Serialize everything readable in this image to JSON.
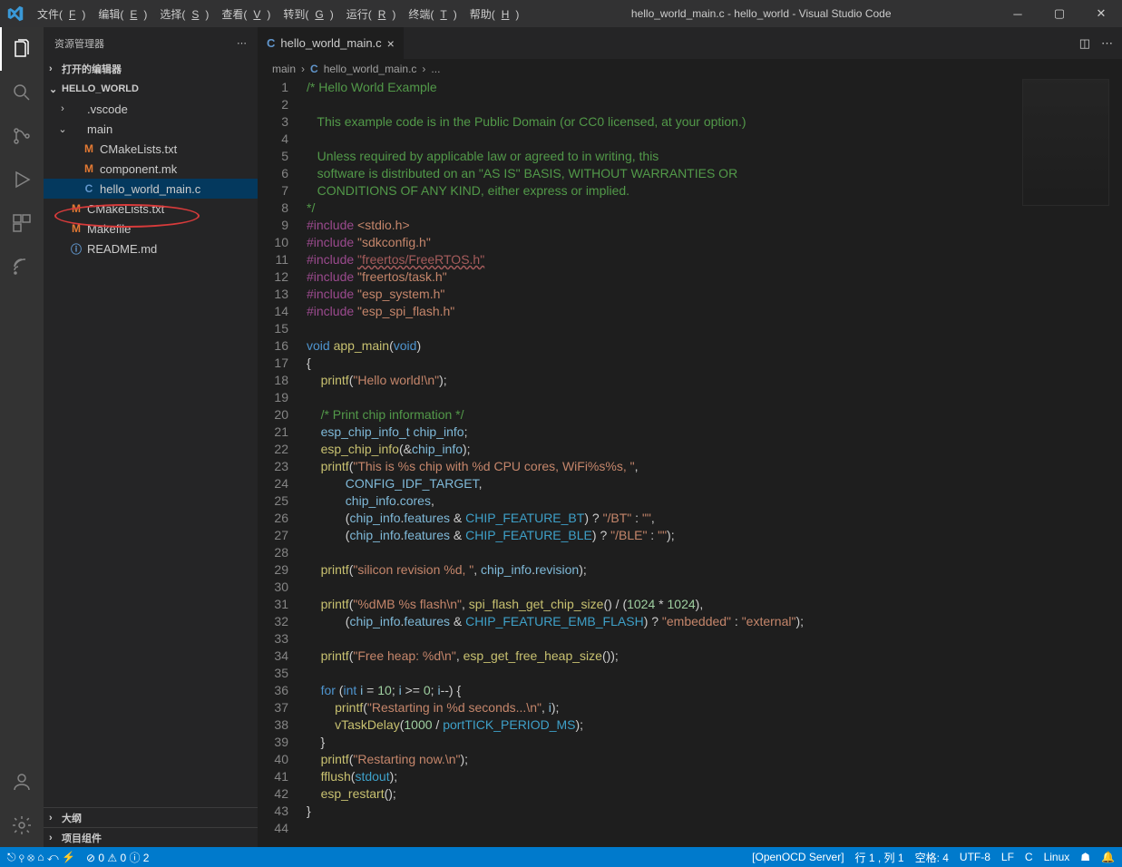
{
  "window": {
    "title": "hello_world_main.c - hello_world - Visual Studio Code"
  },
  "menus": [
    "文件(F)",
    "编辑(E)",
    "选择(S)",
    "查看(V)",
    "转到(G)",
    "运行(R)",
    "终端(T)",
    "帮助(H)"
  ],
  "sidebar": {
    "title": "资源管理器",
    "sections": {
      "openEditors": "打开的编辑器",
      "project": "HELLO_WORLD",
      "outline": "大纲",
      "projectComp": "项目组件"
    },
    "tree": [
      {
        "indent": 0,
        "chev": "›",
        "icon": "",
        "iconColor": "",
        "label": ".vscode"
      },
      {
        "indent": 0,
        "chev": "⌄",
        "icon": "",
        "iconColor": "",
        "label": "main"
      },
      {
        "indent": 1,
        "chev": "",
        "icon": "M",
        "iconColor": "#e37933",
        "label": "CMakeLists.txt"
      },
      {
        "indent": 1,
        "chev": "",
        "icon": "M",
        "iconColor": "#e37933",
        "label": "component.mk"
      },
      {
        "indent": 1,
        "chev": "",
        "icon": "C",
        "iconColor": "#6196cc",
        "label": "hello_world_main.c",
        "selected": true
      },
      {
        "indent": 0,
        "chev": "",
        "icon": "M",
        "iconColor": "#e37933",
        "label": "CMakeLists.txt"
      },
      {
        "indent": 0,
        "chev": "",
        "icon": "M",
        "iconColor": "#e37933",
        "label": "Makefile"
      },
      {
        "indent": 0,
        "chev": "",
        "icon": "ⓘ",
        "iconColor": "#6196cc",
        "label": "README.md"
      }
    ]
  },
  "tab": {
    "icon": "C",
    "label": "hello_world_main.c"
  },
  "breadcrumb": [
    "main",
    "hello_world_main.c",
    "..."
  ],
  "code": {
    "firstLine": 1,
    "lines": [
      [
        {
          "c": "cm",
          "t": "/* Hello World Example"
        }
      ],
      [
        {
          "c": "cm",
          "t": ""
        }
      ],
      [
        {
          "c": "cm",
          "t": "   This example code is in the Public Domain (or CC0 licensed, at your option.)"
        }
      ],
      [
        {
          "c": "cm",
          "t": ""
        }
      ],
      [
        {
          "c": "cm",
          "t": "   Unless required by applicable law or agreed to in writing, this"
        }
      ],
      [
        {
          "c": "cm",
          "t": "   software is distributed on an \"AS IS\" BASIS, WITHOUT WARRANTIES OR"
        }
      ],
      [
        {
          "c": "cm",
          "t": "   CONDITIONS OF ANY KIND, either express or implied."
        }
      ],
      [
        {
          "c": "cm",
          "t": "*/"
        }
      ],
      [
        {
          "c": "pp",
          "t": "#include "
        },
        {
          "c": "s",
          "t": "<stdio.h>"
        }
      ],
      [
        {
          "c": "pp",
          "t": "#include "
        },
        {
          "c": "s",
          "t": "\"sdkconfig.h\""
        }
      ],
      [
        {
          "c": "pp",
          "t": "#include "
        },
        {
          "c": "sq",
          "t": "\"freertos/FreeRTOS.h\""
        }
      ],
      [
        {
          "c": "pp",
          "t": "#include "
        },
        {
          "c": "s",
          "t": "\"freertos/task.h\""
        }
      ],
      [
        {
          "c": "pp",
          "t": "#include "
        },
        {
          "c": "s",
          "t": "\"esp_system.h\""
        }
      ],
      [
        {
          "c": "pp",
          "t": "#include "
        },
        {
          "c": "s",
          "t": "\"esp_spi_flash.h\""
        }
      ],
      [],
      [
        {
          "c": "kw",
          "t": "void "
        },
        {
          "c": "fn",
          "t": "app_main"
        },
        {
          "t": "("
        },
        {
          "c": "kw",
          "t": "void"
        },
        {
          "t": ")"
        }
      ],
      [
        {
          "t": "{"
        }
      ],
      [
        {
          "t": "    "
        },
        {
          "c": "fn",
          "t": "printf"
        },
        {
          "t": "("
        },
        {
          "c": "s",
          "t": "\"Hello world!\\n\""
        },
        {
          "t": ");"
        }
      ],
      [],
      [
        {
          "t": "    "
        },
        {
          "c": "cm",
          "t": "/* Print chip information */"
        }
      ],
      [
        {
          "t": "    "
        },
        {
          "c": "vr",
          "t": "esp_chip_info_t"
        },
        {
          "t": " "
        },
        {
          "c": "vr",
          "t": "chip_info"
        },
        {
          "t": ";"
        }
      ],
      [
        {
          "t": "    "
        },
        {
          "c": "fn",
          "t": "esp_chip_info"
        },
        {
          "t": "(&"
        },
        {
          "c": "vr",
          "t": "chip_info"
        },
        {
          "t": ");"
        }
      ],
      [
        {
          "t": "    "
        },
        {
          "c": "fn",
          "t": "printf"
        },
        {
          "t": "("
        },
        {
          "c": "s",
          "t": "\"This is %s chip with %d CPU cores, WiFi%s%s, \""
        },
        {
          "t": ","
        }
      ],
      [
        {
          "t": "           "
        },
        {
          "c": "vr",
          "t": "CONFIG_IDF_TARGET"
        },
        {
          "t": ","
        }
      ],
      [
        {
          "t": "           "
        },
        {
          "c": "vr",
          "t": "chip_info"
        },
        {
          "t": "."
        },
        {
          "c": "vr",
          "t": "cores"
        },
        {
          "t": ","
        }
      ],
      [
        {
          "t": "           ("
        },
        {
          "c": "vr",
          "t": "chip_info"
        },
        {
          "t": "."
        },
        {
          "c": "vr",
          "t": "features"
        },
        {
          "t": " & "
        },
        {
          "c": "cn",
          "t": "CHIP_FEATURE_BT"
        },
        {
          "t": ") ? "
        },
        {
          "c": "s",
          "t": "\"/BT\""
        },
        {
          "t": " : "
        },
        {
          "c": "s",
          "t": "\"\""
        },
        {
          "t": ","
        }
      ],
      [
        {
          "t": "           ("
        },
        {
          "c": "vr",
          "t": "chip_info"
        },
        {
          "t": "."
        },
        {
          "c": "vr",
          "t": "features"
        },
        {
          "t": " & "
        },
        {
          "c": "cn",
          "t": "CHIP_FEATURE_BLE"
        },
        {
          "t": ") ? "
        },
        {
          "c": "s",
          "t": "\"/BLE\""
        },
        {
          "t": " : "
        },
        {
          "c": "s",
          "t": "\"\""
        },
        {
          "t": ");"
        }
      ],
      [],
      [
        {
          "t": "    "
        },
        {
          "c": "fn",
          "t": "printf"
        },
        {
          "t": "("
        },
        {
          "c": "s",
          "t": "\"silicon revision %d, \""
        },
        {
          "t": ", "
        },
        {
          "c": "vr",
          "t": "chip_info"
        },
        {
          "t": "."
        },
        {
          "c": "vr",
          "t": "revision"
        },
        {
          "t": ");"
        }
      ],
      [],
      [
        {
          "t": "    "
        },
        {
          "c": "fn",
          "t": "printf"
        },
        {
          "t": "("
        },
        {
          "c": "s",
          "t": "\"%dMB %s flash\\n\""
        },
        {
          "t": ", "
        },
        {
          "c": "fn",
          "t": "spi_flash_get_chip_size"
        },
        {
          "t": "() / ("
        },
        {
          "c": "nm",
          "t": "1024"
        },
        {
          "t": " * "
        },
        {
          "c": "nm",
          "t": "1024"
        },
        {
          "t": "),"
        }
      ],
      [
        {
          "t": "           ("
        },
        {
          "c": "vr",
          "t": "chip_info"
        },
        {
          "t": "."
        },
        {
          "c": "vr",
          "t": "features"
        },
        {
          "t": " & "
        },
        {
          "c": "cn",
          "t": "CHIP_FEATURE_EMB_FLASH"
        },
        {
          "t": ") ? "
        },
        {
          "c": "s",
          "t": "\"embedded\""
        },
        {
          "t": " : "
        },
        {
          "c": "s",
          "t": "\"external\""
        },
        {
          "t": ");"
        }
      ],
      [],
      [
        {
          "t": "    "
        },
        {
          "c": "fn",
          "t": "printf"
        },
        {
          "t": "("
        },
        {
          "c": "s",
          "t": "\"Free heap: %d\\n\""
        },
        {
          "t": ", "
        },
        {
          "c": "fn",
          "t": "esp_get_free_heap_size"
        },
        {
          "t": "());"
        }
      ],
      [],
      [
        {
          "t": "    "
        },
        {
          "c": "kw",
          "t": "for"
        },
        {
          "t": " ("
        },
        {
          "c": "kw",
          "t": "int"
        },
        {
          "t": " "
        },
        {
          "c": "vr",
          "t": "i"
        },
        {
          "t": " = "
        },
        {
          "c": "nm",
          "t": "10"
        },
        {
          "t": "; "
        },
        {
          "c": "vr",
          "t": "i"
        },
        {
          "t": " >= "
        },
        {
          "c": "nm",
          "t": "0"
        },
        {
          "t": "; "
        },
        {
          "c": "vr",
          "t": "i"
        },
        {
          "t": "--) {"
        }
      ],
      [
        {
          "t": "        "
        },
        {
          "c": "fn",
          "t": "printf"
        },
        {
          "t": "("
        },
        {
          "c": "s",
          "t": "\"Restarting in %d seconds...\\n\""
        },
        {
          "t": ", "
        },
        {
          "c": "vr",
          "t": "i"
        },
        {
          "t": ");"
        }
      ],
      [
        {
          "t": "        "
        },
        {
          "c": "fn",
          "t": "vTaskDelay"
        },
        {
          "t": "("
        },
        {
          "c": "nm",
          "t": "1000"
        },
        {
          "t": " / "
        },
        {
          "c": "cn",
          "t": "portTICK_PERIOD_MS"
        },
        {
          "t": ");"
        }
      ],
      [
        {
          "t": "    }"
        }
      ],
      [
        {
          "t": "    "
        },
        {
          "c": "fn",
          "t": "printf"
        },
        {
          "t": "("
        },
        {
          "c": "s",
          "t": "\"Restarting now.\\n\""
        },
        {
          "t": ");"
        }
      ],
      [
        {
          "t": "    "
        },
        {
          "c": "fn",
          "t": "fflush"
        },
        {
          "t": "("
        },
        {
          "c": "cn",
          "t": "stdout"
        },
        {
          "t": ");"
        }
      ],
      [
        {
          "t": "    "
        },
        {
          "c": "fn",
          "t": "esp_restart"
        },
        {
          "t": "();"
        }
      ],
      [
        {
          "t": "}"
        }
      ],
      []
    ]
  },
  "status": {
    "left": [
      "⎋",
      "⚲",
      "⊗",
      "⌂",
      "⤺",
      "⚡"
    ],
    "errWarn": "⊘ 0 ⚠ 0 ⓘ 2",
    "server": "[OpenOCD Server]",
    "pos": "行 1 , 列 1",
    "spaces": "空格: 4",
    "enc": "UTF-8",
    "eol": "LF",
    "lang": "C",
    "os": "Linux"
  }
}
